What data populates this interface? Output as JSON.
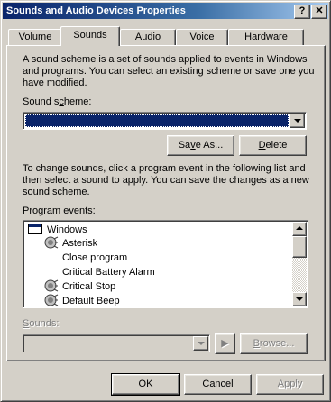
{
  "window": {
    "title": "Sounds and Audio Devices Properties",
    "help_btn": "?",
    "close_btn": "✕"
  },
  "tabs": [
    {
      "label": "Volume"
    },
    {
      "label": "Sounds"
    },
    {
      "label": "Audio"
    },
    {
      "label": "Voice"
    },
    {
      "label": "Hardware"
    }
  ],
  "sounds": {
    "intro_line1": "A sound scheme is a set of sounds applied to events in Windows",
    "intro_line2": "and programs.  You can select an existing scheme or save one you",
    "intro_line3": "have modified.",
    "scheme_label_pre": "Sound s",
    "scheme_label_ul": "c",
    "scheme_label_post": "heme:",
    "scheme_value": "",
    "save_as_pre": "Sa",
    "save_as_ul": "v",
    "save_as_post": "e As...",
    "delete_ul": "D",
    "delete_post": "elete",
    "events_intro_line1": "To change sounds, click a program event in the following list and",
    "events_intro_line2": "then select a sound to apply.  You can save the changes as a new",
    "events_intro_line3": "sound scheme.",
    "events_label_ul": "P",
    "events_label_post": "rogram events:",
    "events": [
      {
        "label": "Windows",
        "icon": "window-icon"
      },
      {
        "label": "Asterisk",
        "icon": "speaker-icon"
      },
      {
        "label": "Close program",
        "icon": ""
      },
      {
        "label": "Critical Battery Alarm",
        "icon": ""
      },
      {
        "label": "Critical Stop",
        "icon": "speaker-icon"
      },
      {
        "label": "Default Beep",
        "icon": "speaker-icon"
      }
    ],
    "sounds_label_ul": "S",
    "sounds_label_post": "ounds:",
    "sounds_value": "",
    "play_icon": "▶",
    "browse_ul": "B",
    "browse_post": "rowse..."
  },
  "footer": {
    "ok": "OK",
    "cancel": "Cancel",
    "apply_ul": "A",
    "apply_post": "pply"
  }
}
